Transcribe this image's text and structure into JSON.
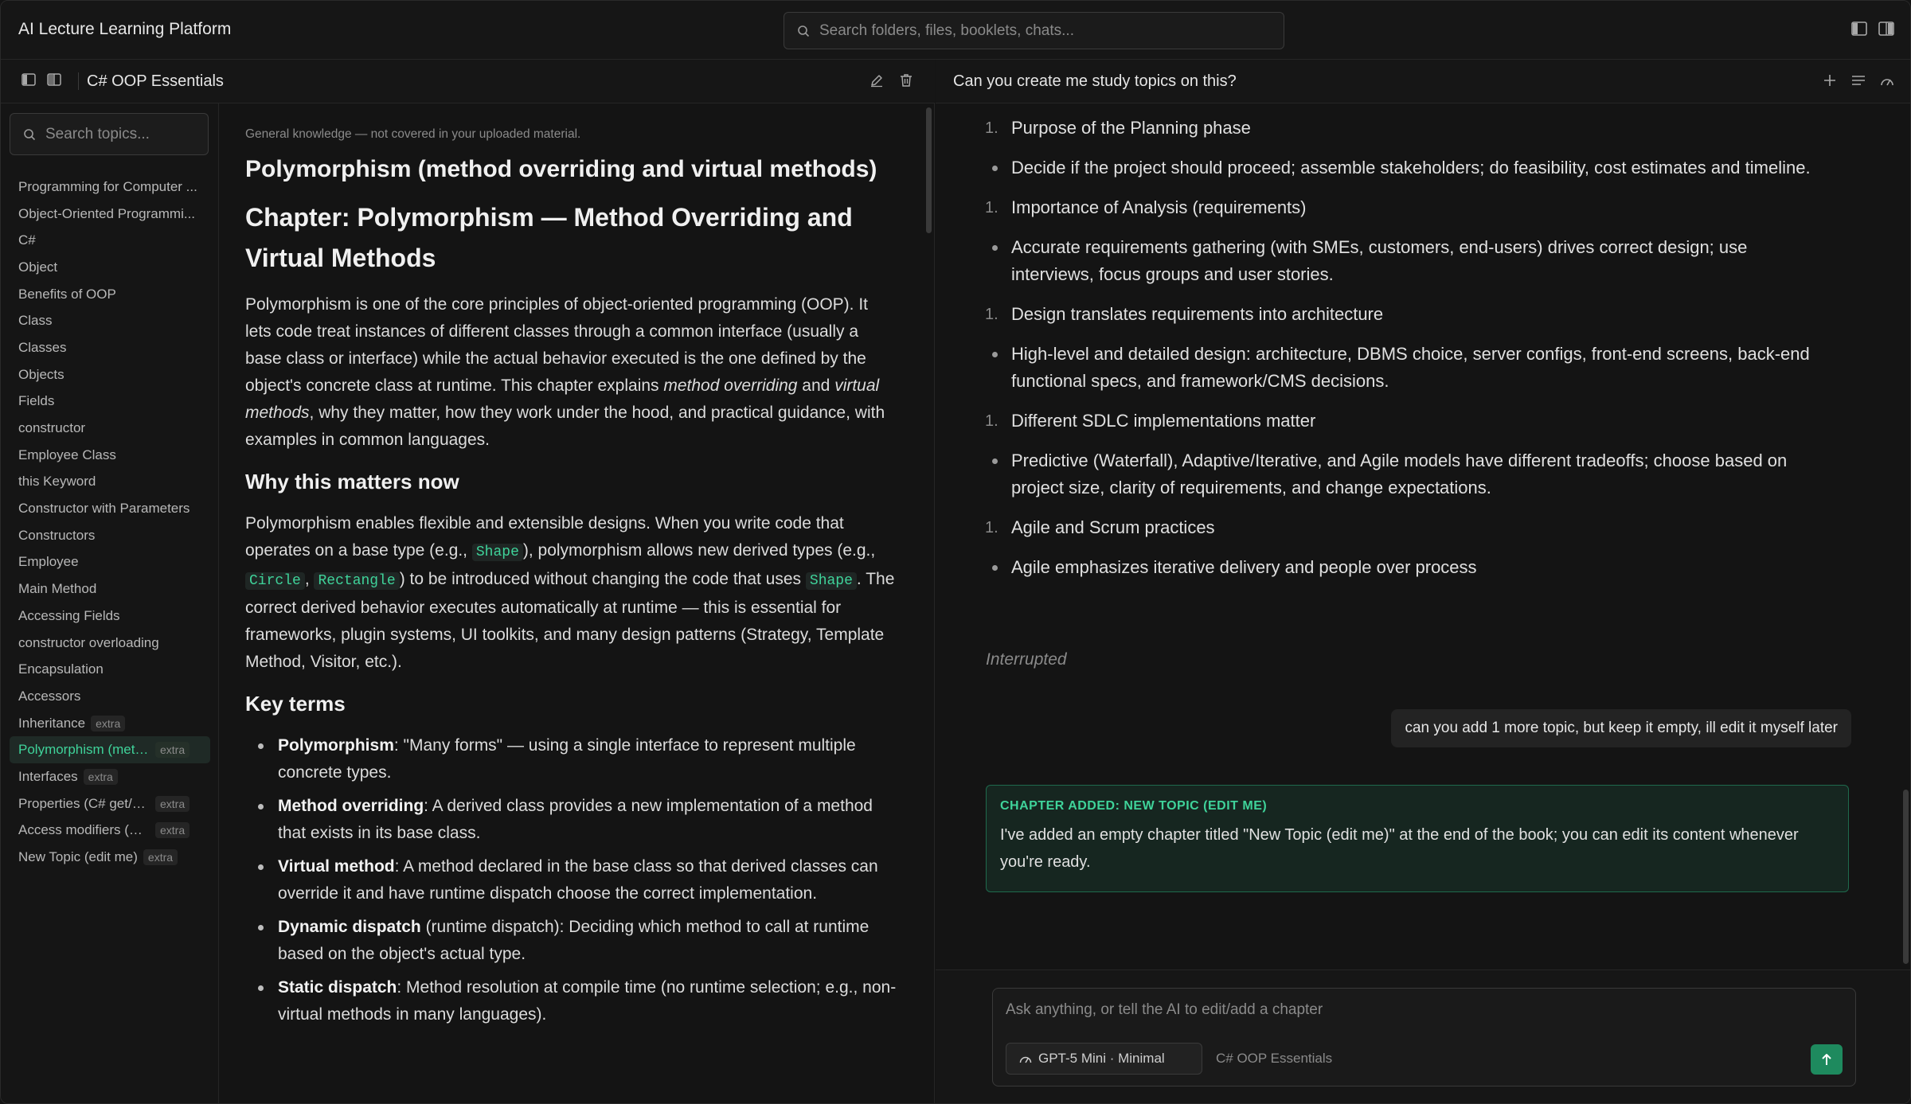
{
  "app": {
    "title": "AI Lecture Learning Platform"
  },
  "global_search": {
    "placeholder": "Search folders, files, booklets, chats..."
  },
  "doc_header": {
    "title": "C# OOP Essentials"
  },
  "sidebar": {
    "search_placeholder": "Search topics...",
    "topics": [
      {
        "label": "Programming for Computer ...",
        "badge": ""
      },
      {
        "label": "Object-Oriented Programmi...",
        "badge": ""
      },
      {
        "label": "C#",
        "badge": ""
      },
      {
        "label": "Object",
        "badge": ""
      },
      {
        "label": "Benefits of OOP",
        "badge": ""
      },
      {
        "label": "Class",
        "badge": ""
      },
      {
        "label": "Classes",
        "badge": ""
      },
      {
        "label": "Objects",
        "badge": ""
      },
      {
        "label": "Fields",
        "badge": ""
      },
      {
        "label": "constructor",
        "badge": ""
      },
      {
        "label": "Employee Class",
        "badge": ""
      },
      {
        "label": "this Keyword",
        "badge": ""
      },
      {
        "label": "Constructor with Parameters",
        "badge": ""
      },
      {
        "label": "Constructors",
        "badge": ""
      },
      {
        "label": "Employee",
        "badge": ""
      },
      {
        "label": "Main Method",
        "badge": ""
      },
      {
        "label": "Accessing Fields",
        "badge": ""
      },
      {
        "label": "constructor overloading",
        "badge": ""
      },
      {
        "label": "Encapsulation",
        "badge": ""
      },
      {
        "label": "Accessors",
        "badge": ""
      },
      {
        "label": "Inheritance",
        "badge": "extra"
      },
      {
        "label": "Polymorphism (meth...",
        "badge": "extra",
        "active": true
      },
      {
        "label": "Interfaces",
        "badge": "extra"
      },
      {
        "label": "Properties (C# get/se...",
        "badge": "extra"
      },
      {
        "label": "Access modifiers (pu...",
        "badge": "extra"
      },
      {
        "label": "New Topic (edit me)",
        "badge": "extra"
      }
    ]
  },
  "doc": {
    "note": "General knowledge — not covered in your uploaded material.",
    "title": "Polymorphism (method overriding and virtual methods)",
    "chapter_title": "Chapter: Polymorphism — Method Overriding and Virtual Methods",
    "intro": {
      "p1": "Polymorphism is one of the core principles of object-oriented programming (OOP). It lets code treat instances of different classes through a common interface (usually a base class or interface) while the actual behavior executed is the one defined by the object's concrete class at runtime. This chapter explains ",
      "em1": "method overriding",
      "p2": " and ",
      "em2": "virtual methods",
      "p3": ", why they matter, how they work under the hood, and practical guidance, with examples in common languages."
    },
    "why_heading": "Why this matters now",
    "why": {
      "t1": "Polymorphism enables flexible and extensible designs. When you write code that operates on a base type (e.g., ",
      "c1": "Shape",
      "t2": "), polymorphism allows new derived types (e.g., ",
      "c2": "Circle",
      "t3": ", ",
      "c3": "Rectangle",
      "t4": ") to be introduced without changing the code that uses ",
      "c4": "Shape",
      "t5": ". The correct derived behavior executes automatically at runtime — this is essential for frameworks, plugin systems, UI toolkits, and many design patterns (Strategy, Template Method, Visitor, etc.)."
    },
    "key_terms_heading": "Key terms",
    "key_terms": [
      {
        "term": "Polymorphism",
        "desc": ": \"Many forms\" — using a single interface to represent multiple concrete types."
      },
      {
        "term": "Method overriding",
        "desc": ": A derived class provides a new implementation of a method that exists in its base class."
      },
      {
        "term": "Virtual method",
        "desc": ": A method declared in the base class so that derived classes can override it and have runtime dispatch choose the correct implementation."
      },
      {
        "term": "Dynamic dispatch",
        "desc": " (runtime dispatch): Deciding which method to call at runtime based on the object's actual type."
      },
      {
        "term": "Static dispatch",
        "desc": ": Method resolution at compile time (no runtime selection; e.g., non-virtual methods in many languages)."
      }
    ]
  },
  "chat": {
    "title": "Can you create me study topics on this?",
    "items": [
      {
        "kind": "num",
        "marker": "1.",
        "text": "Purpose of the Planning phase"
      },
      {
        "kind": "bullet",
        "marker": "",
        "text": "Decide if the project should proceed; assemble stakeholders; do feasibility, cost estimates and timeline."
      },
      {
        "kind": "num",
        "marker": "1.",
        "text": "Importance of Analysis (requirements)"
      },
      {
        "kind": "bullet",
        "marker": "",
        "text": "Accurate requirements gathering (with SMEs, customers, end-users) drives correct design; use interviews, focus groups and user stories."
      },
      {
        "kind": "num",
        "marker": "1.",
        "text": "Design translates requirements into architecture"
      },
      {
        "kind": "bullet",
        "marker": "",
        "text": "High-level and detailed design: architecture, DBMS choice, server configs, front-end screens, back-end functional specs, and framework/CMS decisions."
      },
      {
        "kind": "num",
        "marker": "1.",
        "text": "Different SDLC implementations matter"
      },
      {
        "kind": "bullet",
        "marker": "",
        "text": "Predictive (Waterfall), Adaptive/Iterative, and Agile models have different tradeoffs; choose based on project size, clarity of requirements, and change expectations."
      },
      {
        "kind": "num",
        "marker": "1.",
        "text": "Agile and Scrum practices"
      },
      {
        "kind": "bullet",
        "marker": "",
        "text": "Agile emphasizes iterative delivery and people over process"
      }
    ],
    "interrupted": "Interrupted",
    "user_message": "can you add 1 more topic, but keep it empty, ill edit it myself later",
    "added_card": {
      "title": "CHAPTER ADDED: NEW TOPIC (EDIT ME)",
      "body": "I've added an empty chapter titled \"New Topic (edit me)\" at the end of the book; you can edit its content whenever you're ready."
    },
    "composer": {
      "placeholder": "Ask anything, or tell the AI to edit/add a chapter",
      "model": "GPT-5 Mini · Minimal",
      "context": "C# OOP Essentials"
    }
  },
  "colors": {
    "accent": "#3fd39a",
    "send_button": "#1e8a5e",
    "background": "#141414"
  },
  "icons": [
    "search-icon",
    "panel-left-icon",
    "panel-split-icon",
    "edit-icon",
    "trash-icon",
    "plus-icon",
    "list-icon",
    "model-icon",
    "send-arrow-icon"
  ]
}
